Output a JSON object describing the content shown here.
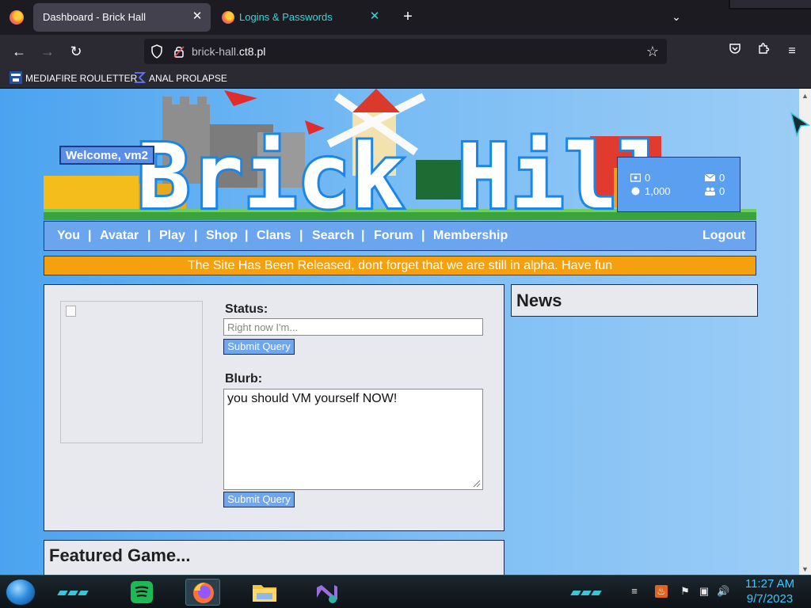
{
  "browser": {
    "tabs": [
      {
        "title": "Dashboard - Brick Hall",
        "active": true
      },
      {
        "title": "Logins & Passwords",
        "active": false
      }
    ],
    "url_host_prefix": "brick-hall.",
    "url_host_domain": "ct8.pl",
    "bookmarks": [
      "MEDIAFIRE ROULETTER",
      "ANAL PROLAPSE"
    ]
  },
  "site": {
    "logo_text": "Brick Hill",
    "welcome": "Welcome, vm2",
    "stats": {
      "bucks": "0",
      "messages": "0",
      "bits": "1,000",
      "friend_requests": "0"
    },
    "nav": [
      "You",
      "Avatar",
      "Play",
      "Shop",
      "Clans",
      "Search",
      "Forum",
      "Membership"
    ],
    "logout": "Logout",
    "alert": "The Site Has Been Released, dont forget that we are still in alpha. Have fun",
    "status_label": "Status:",
    "status_placeholder": "Right now I'm...",
    "submit_label": "Submit Query",
    "blurb_label": "Blurb:",
    "blurb_value": "you should VM yourself NOW!",
    "news_title": "News",
    "featured_title": "Featured Game..."
  },
  "taskbar": {
    "time": "11:27 AM",
    "date": "9/7/2023"
  },
  "colors": {
    "accent_blue": "#5b8fe6",
    "alert_orange": "#f5a10f",
    "panel_bg": "#e8e9ef",
    "clock_cyan": "#3ac6ff"
  }
}
